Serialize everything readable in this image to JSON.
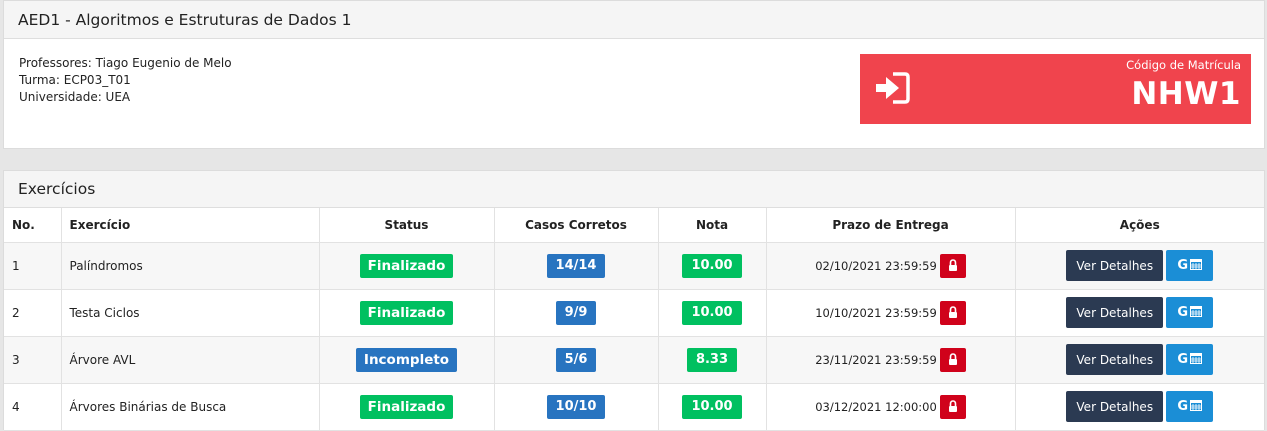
{
  "course": {
    "title": "AED1 - Algoritmos e Estruturas de Dados 1",
    "professors": "Professores: Tiago Eugenio de Melo",
    "class": "Turma: ECP03_T01",
    "university": "Universidade: UEA",
    "enrollment_label": "Código de Matrícula",
    "enrollment_code": "NHW1"
  },
  "exercises": {
    "title": "Exercícios",
    "headers": {
      "no": "No.",
      "exercise": "Exercício",
      "status": "Status",
      "cases": "Casos Corretos",
      "grade": "Nota",
      "deadline": "Prazo de Entrega",
      "actions": "Ações"
    },
    "rows": [
      {
        "no": "1",
        "name": "Palíndromos",
        "status": "Finalizado",
        "cases": "14/14",
        "grade": "10.00",
        "deadline": "02/10/2021 23:59:59",
        "details": "Ver Detalhes",
        "cal_letter": "G"
      },
      {
        "no": "2",
        "name": "Testa Ciclos",
        "status": "Finalizado",
        "cases": "9/9",
        "grade": "10.00",
        "deadline": "10/10/2021 23:59:59",
        "details": "Ver Detalhes",
        "cal_letter": "G"
      },
      {
        "no": "3",
        "name": "Árvore AVL",
        "status": "Incompleto",
        "cases": "5/6",
        "grade": "8.33",
        "deadline": "23/11/2021 23:59:59",
        "details": "Ver Detalhes",
        "cal_letter": "G"
      },
      {
        "no": "4",
        "name": "Árvores Binárias de Busca",
        "status": "Finalizado",
        "cases": "10/10",
        "grade": "10.00",
        "deadline": "03/12/2021 12:00:00",
        "details": "Ver Detalhes",
        "cal_letter": "G"
      }
    ]
  },
  "colors": {
    "enroll_bg": "#f0444d",
    "finalizado": "#00c060",
    "incompleto": "#2874c0",
    "lock": "#d0021b",
    "details_btn": "#2b3a52",
    "calendar_btn": "#1b8ed6"
  },
  "icons": {
    "enroll": "sign-in-icon",
    "lock": "lock-icon",
    "calendar": "calendar-icon"
  }
}
